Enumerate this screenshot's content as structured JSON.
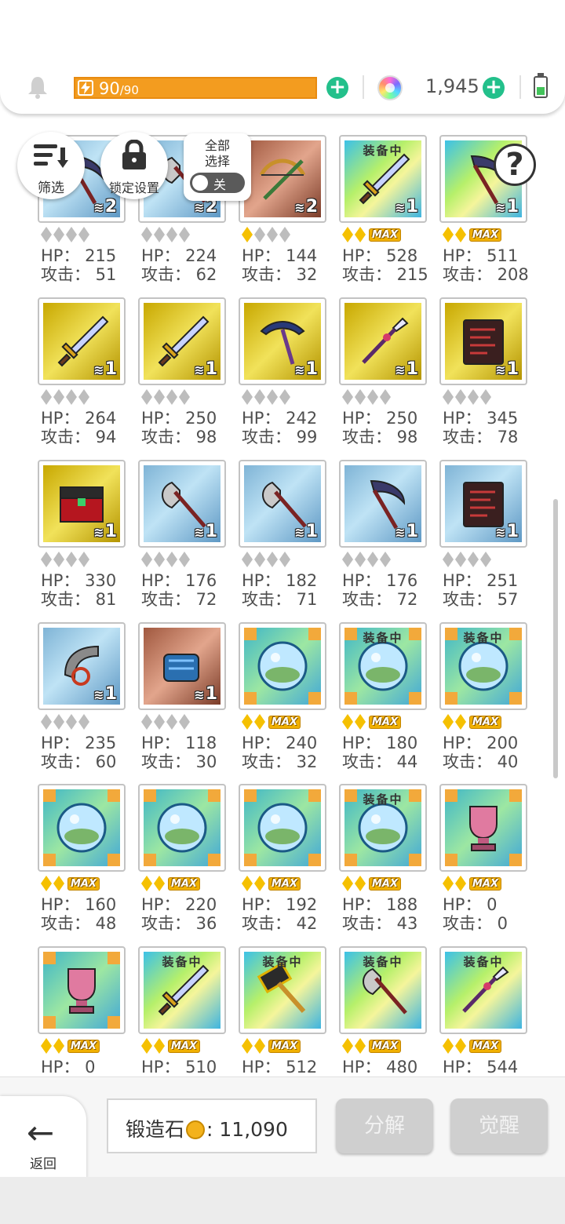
{
  "topbar": {
    "energy_current": "90",
    "energy_max": "/90",
    "energy_fill": 1.0,
    "gem_count": "1,945"
  },
  "controls": {
    "filter_label": "筛选",
    "lock_label": "锁定设置",
    "select_all_label": "全部\n选择",
    "toggle_label": "关",
    "help_label": "?"
  },
  "colors": {
    "accent_green": "#23c08b",
    "energy_orange": "#f39c1f",
    "disabled_button": "#cfcfcf",
    "rank_gold": "#f5c000",
    "rank_gray": "#bdbdbd"
  },
  "equipped_label": "装备中",
  "hp_label": "HP：",
  "atk_label": "攻击：",
  "max_label": "MAX",
  "items": [
    {
      "icon": "scythe-icon",
      "bg": "bg-blue",
      "qty": "2",
      "equipped": false,
      "rank": "gray",
      "hp": "215",
      "atk": "51"
    },
    {
      "icon": "axe-icon",
      "bg": "bg-blue",
      "qty": "2",
      "equipped": false,
      "rank": "gray",
      "hp": "224",
      "atk": "62"
    },
    {
      "icon": "crossbow-icon",
      "bg": "bg-brown",
      "qty": "2",
      "equipped": false,
      "rank": "gold1",
      "hp": "144",
      "atk": "32"
    },
    {
      "icon": "sword-icon",
      "bg": "bg-rainbow",
      "qty": "1",
      "equipped": true,
      "rank": "max",
      "hp": "528",
      "atk": "215"
    },
    {
      "icon": "scythe-icon",
      "bg": "bg-rainbow",
      "qty": "1",
      "equipped": false,
      "rank": "max",
      "hp": "511",
      "atk": "208"
    },
    {
      "icon": "sword-icon",
      "bg": "bg-gold",
      "qty": "1",
      "equipped": false,
      "rank": "gray",
      "hp": "264",
      "atk": "94"
    },
    {
      "icon": "sword-icon",
      "bg": "bg-gold",
      "qty": "1",
      "equipped": false,
      "rank": "gray",
      "hp": "250",
      "atk": "98"
    },
    {
      "icon": "pickaxe-icon",
      "bg": "bg-gold",
      "qty": "1",
      "equipped": false,
      "rank": "gray",
      "hp": "242",
      "atk": "99"
    },
    {
      "icon": "spear-icon",
      "bg": "bg-gold",
      "qty": "1",
      "equipped": false,
      "rank": "gray",
      "hp": "250",
      "atk": "98"
    },
    {
      "icon": "spellbook-icon",
      "bg": "bg-gold",
      "qty": "1",
      "equipped": false,
      "rank": "gray",
      "hp": "345",
      "atk": "78"
    },
    {
      "icon": "chest-icon",
      "bg": "bg-gold",
      "qty": "1",
      "equipped": false,
      "rank": "gray",
      "hp": "330",
      "atk": "81"
    },
    {
      "icon": "axe-icon",
      "bg": "bg-blue",
      "qty": "1",
      "equipped": false,
      "rank": "gray",
      "hp": "176",
      "atk": "72"
    },
    {
      "icon": "axe-icon",
      "bg": "bg-blue",
      "qty": "1",
      "equipped": false,
      "rank": "gray",
      "hp": "182",
      "atk": "71"
    },
    {
      "icon": "scythe-icon",
      "bg": "bg-blue",
      "qty": "1",
      "equipped": false,
      "rank": "gray",
      "hp": "176",
      "atk": "72"
    },
    {
      "icon": "spellbook-icon",
      "bg": "bg-blue",
      "qty": "1",
      "equipped": false,
      "rank": "gray",
      "hp": "251",
      "atk": "57"
    },
    {
      "icon": "bracer-icon",
      "bg": "bg-blue",
      "qty": "1",
      "equipped": false,
      "rank": "gray",
      "hp": "235",
      "atk": "60"
    },
    {
      "icon": "gauntlet-icon",
      "bg": "bg-brown",
      "qty": "1",
      "equipped": false,
      "rank": "gray",
      "hp": "118",
      "atk": "30"
    },
    {
      "icon": "orb-icon",
      "bg": "bg-teal",
      "qty": "",
      "equipped": false,
      "rank": "max",
      "hp": "240",
      "atk": "32"
    },
    {
      "icon": "orb-icon",
      "bg": "bg-teal",
      "qty": "",
      "equipped": true,
      "rank": "max",
      "hp": "180",
      "atk": "44"
    },
    {
      "icon": "orb-icon",
      "bg": "bg-teal",
      "qty": "",
      "equipped": true,
      "rank": "max",
      "hp": "200",
      "atk": "40"
    },
    {
      "icon": "orb-icon",
      "bg": "bg-teal",
      "qty": "",
      "equipped": false,
      "rank": "max",
      "hp": "160",
      "atk": "48"
    },
    {
      "icon": "orb-icon",
      "bg": "bg-teal",
      "qty": "",
      "equipped": false,
      "rank": "max",
      "hp": "220",
      "atk": "36"
    },
    {
      "icon": "orb-icon",
      "bg": "bg-teal",
      "qty": "",
      "equipped": false,
      "rank": "max",
      "hp": "192",
      "atk": "42"
    },
    {
      "icon": "orb-icon",
      "bg": "bg-teal",
      "qty": "",
      "equipped": true,
      "rank": "max",
      "hp": "188",
      "atk": "43"
    },
    {
      "icon": "trophy-icon",
      "bg": "bg-teal",
      "qty": "",
      "equipped": false,
      "rank": "max",
      "hp": "0",
      "atk": "0"
    },
    {
      "icon": "trophy-icon",
      "bg": "bg-teal",
      "qty": "",
      "equipped": false,
      "rank": "max",
      "hp": "0",
      "atk": ""
    },
    {
      "icon": "sword-icon",
      "bg": "bg-rainbow",
      "qty": "",
      "equipped": true,
      "rank": "max",
      "hp": "510",
      "atk": ""
    },
    {
      "icon": "hammer-icon",
      "bg": "bg-rainbow",
      "qty": "",
      "equipped": true,
      "rank": "max",
      "hp": "512",
      "atk": ""
    },
    {
      "icon": "axe-icon",
      "bg": "bg-rainbow",
      "qty": "",
      "equipped": true,
      "rank": "max",
      "hp": "480",
      "atk": ""
    },
    {
      "icon": "spear-icon",
      "bg": "bg-rainbow",
      "qty": "",
      "equipped": true,
      "rank": "max",
      "hp": "544",
      "atk": ""
    }
  ],
  "bottombar": {
    "back_label": "返回",
    "forge_label": "锻造石",
    "forge_value": "11,090",
    "disassemble_label": "分解",
    "awaken_label": "觉醒"
  }
}
